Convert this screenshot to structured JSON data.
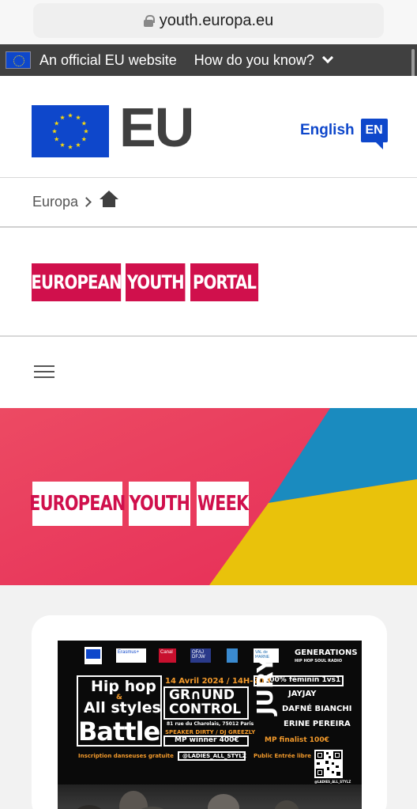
{
  "browser": {
    "url": "youth.europa.eu"
  },
  "eu_banner": {
    "official_text": "An official EU website",
    "how_text": "How do you know?"
  },
  "header": {
    "logo_text": "EU",
    "language_label": "English",
    "language_code": "EN"
  },
  "breadcrumb": {
    "items": [
      "Europa"
    ]
  },
  "portal_logo": {
    "words": [
      "EUROPEAN",
      "YOUTH",
      "PORTAL"
    ]
  },
  "hero": {
    "words": [
      "EUROPEAN",
      "YOUTH",
      "WEEK"
    ]
  },
  "poster": {
    "date_time": "14 Avril 2024 / 14H-20H",
    "headline_1": "Hip hop",
    "headline_amp": "&",
    "headline_2": "All styles",
    "headline_3": "Battle",
    "venue_name_1": "GR∩UND",
    "venue_name_2": "CONTROL",
    "address": "81 rue du Charolais, 75012 Paris",
    "speaker": "SPEAKER DIRTY / DJ GREEZLY",
    "category": "100% féminin 1vs1",
    "jury_label": "JURY",
    "jury": [
      "JAYJAY",
      "DAFNÉ BIANCHI",
      "ERINE PEREIRA"
    ],
    "prize_winner": "MP winner 400€",
    "prize_finalist": "MP finalist 100€",
    "registration": "Inscription danseuses gratuite",
    "handle": "@LADIES_ALL_STYLZ",
    "public": "Public Entrée libre",
    "top_logo": "GENERATIONS",
    "top_logo_sub": "HIP HOP SOUL RADIO",
    "qr_caption": "@LADIES_ALL_STYLZ",
    "partner_labels": [
      "Erasmus+",
      "Canal",
      "OFAJ DFJW",
      "VAL de MARNE"
    ]
  },
  "colors": {
    "eu_blue": "#0e47cb",
    "eu_yellow": "#f8d80b",
    "portal_red": "#d0104c",
    "hero_pink": "#e8335a",
    "hero_blue": "#1a8bbf",
    "hero_yellow": "#e9c20b"
  }
}
